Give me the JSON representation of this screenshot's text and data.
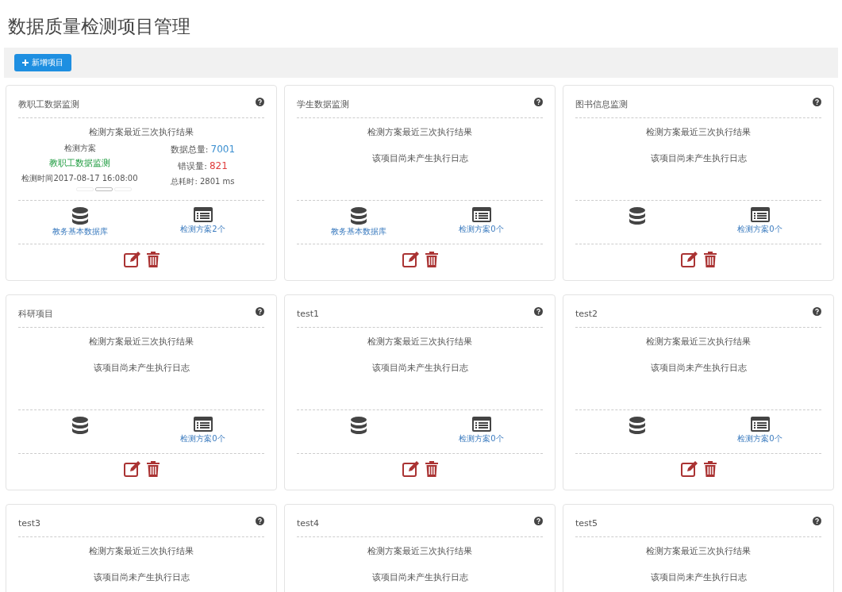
{
  "page_title": "数据质量检测项目管理",
  "toolbar": {
    "add_button": "新增项目"
  },
  "cards": [
    {
      "title": "教职工数据监测",
      "results_heading": "检测方案最近三次执行结果",
      "result": {
        "scheme_label": "检测方案",
        "scheme_name": "教职工数据监测",
        "time": "检测时间2017-08-17 16:08:00",
        "total_label": "数据总量:",
        "total_value": "7001",
        "error_label": "错误量:",
        "error_value": "821",
        "duration": "总耗时: 2801 ms",
        "carousel": [
          {
            "selected": false
          },
          {
            "selected": true
          },
          {
            "selected": false
          }
        ]
      },
      "footer": {
        "database": "教务基本数据库",
        "schemes": "检测方案2个"
      }
    },
    {
      "title": "学生数据监测",
      "results_heading": "检测方案最近三次执行结果",
      "note": "该项目尚未产生执行日志",
      "footer": {
        "database": "教务基本数据库",
        "schemes": "检测方案0个"
      }
    },
    {
      "title": "图书信息监测",
      "results_heading": "检测方案最近三次执行结果",
      "note": "该项目尚未产生执行日志",
      "footer": {
        "schemes": "检测方案0个"
      }
    },
    {
      "title": "科研项目",
      "results_heading": "检测方案最近三次执行结果",
      "note": "该项目尚未产生执行日志",
      "footer": {
        "schemes": "检测方案0个"
      }
    },
    {
      "title": "test1",
      "results_heading": "检测方案最近三次执行结果",
      "note": "该项目尚未产生执行日志",
      "footer": {
        "schemes": "检测方案0个"
      }
    },
    {
      "title": "test2",
      "results_heading": "检测方案最近三次执行结果",
      "note": "该项目尚未产生执行日志",
      "footer": {
        "schemes": "检测方案0个"
      }
    },
    {
      "title": "test3",
      "results_heading": "检测方案最近三次执行结果",
      "note": "该项目尚未产生执行日志"
    },
    {
      "title": "test4",
      "results_heading": "检测方案最近三次执行结果",
      "note": "该项目尚未产生执行日志"
    },
    {
      "title": "test5",
      "results_heading": "检测方案最近三次执行结果",
      "note": "该项目尚未产生执行日志"
    }
  ]
}
